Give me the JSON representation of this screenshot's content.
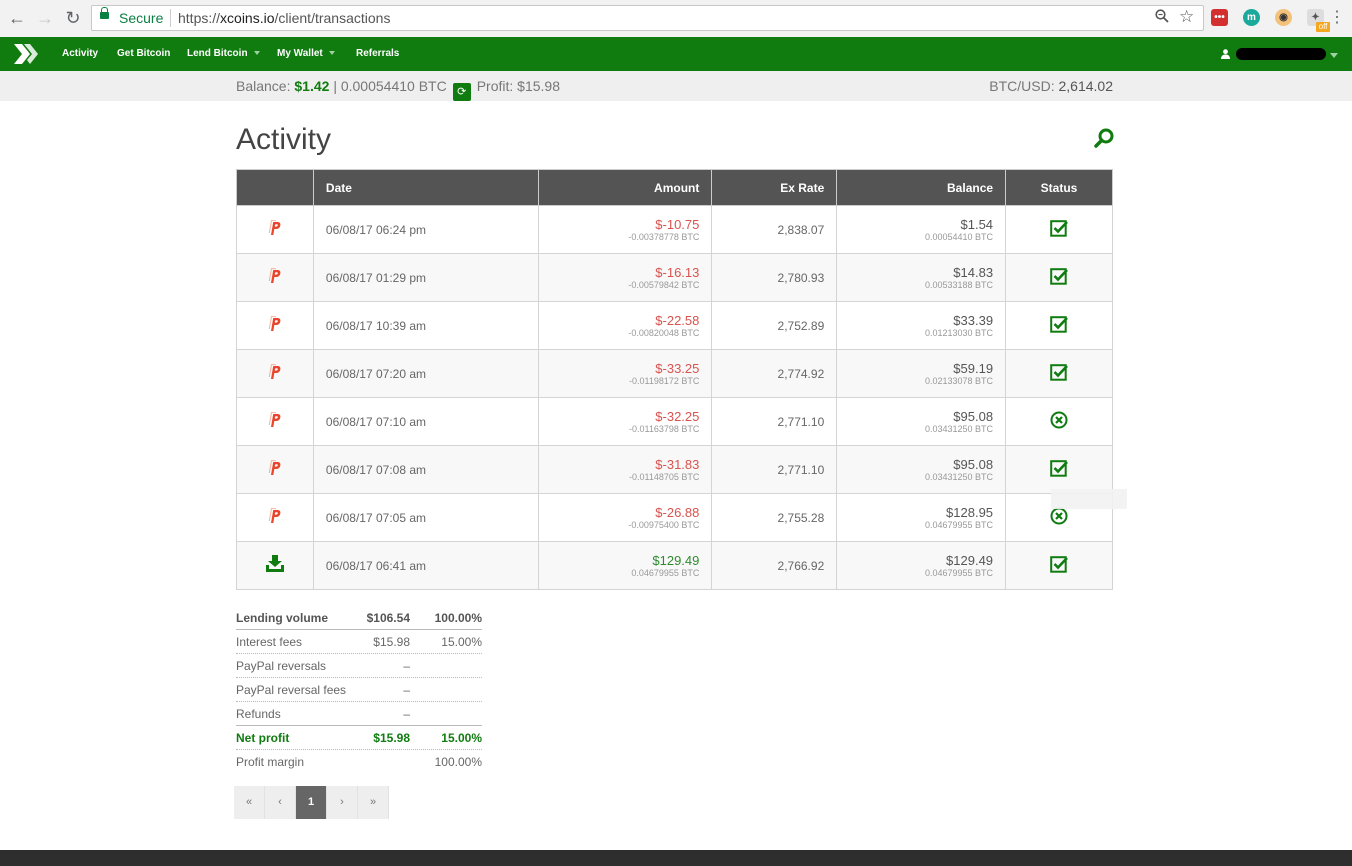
{
  "browser": {
    "secure_label": "Secure",
    "url_scheme": "https://",
    "url_host": "xcoins.io",
    "url_path": "/client/transactions",
    "extension_off_label": "off"
  },
  "nav": {
    "items": [
      {
        "label": "Activity",
        "dropdown": false
      },
      {
        "label": "Get Bitcoin",
        "dropdown": false
      },
      {
        "label": "Lend Bitcoin",
        "dropdown": true
      },
      {
        "label": "My Wallet",
        "dropdown": true
      },
      {
        "label": "Referrals",
        "dropdown": false
      }
    ]
  },
  "balance_bar": {
    "balance_label": "Balance:",
    "balance_usd": "$1.42",
    "balance_btc": "| 0.00054410 BTC",
    "profit_label": "Profit:",
    "profit_value": "$15.98",
    "rate_label": "BTC/USD:",
    "rate_value": "2,614.02"
  },
  "page": {
    "title": "Activity"
  },
  "table": {
    "headers": {
      "date": "Date",
      "amount": "Amount",
      "ex_rate": "Ex Rate",
      "balance": "Balance",
      "status": "Status"
    },
    "rows": [
      {
        "type": "paypal",
        "date": "06/08/17 06:24 pm",
        "amount": "$-10.75",
        "amount_btc": "-0.00378778 BTC",
        "positive": false,
        "ex_rate": "2,838.07",
        "balance": "$1.54",
        "balance_btc": "0.00054410 BTC",
        "status": "complete"
      },
      {
        "type": "paypal",
        "date": "06/08/17 01:29 pm",
        "amount": "$-16.13",
        "amount_btc": "-0.00579842 BTC",
        "positive": false,
        "ex_rate": "2,780.93",
        "balance": "$14.83",
        "balance_btc": "0.00533188 BTC",
        "status": "complete"
      },
      {
        "type": "paypal",
        "date": "06/08/17 10:39 am",
        "amount": "$-22.58",
        "amount_btc": "-0.00820048 BTC",
        "positive": false,
        "ex_rate": "2,752.89",
        "balance": "$33.39",
        "balance_btc": "0.01213030 BTC",
        "status": "complete"
      },
      {
        "type": "paypal",
        "date": "06/08/17 07:20 am",
        "amount": "$-33.25",
        "amount_btc": "-0.01198172 BTC",
        "positive": false,
        "ex_rate": "2,774.92",
        "balance": "$59.19",
        "balance_btc": "0.02133078 BTC",
        "status": "complete"
      },
      {
        "type": "paypal",
        "date": "06/08/17 07:10 am",
        "amount": "$-32.25",
        "amount_btc": "-0.01163798 BTC",
        "positive": false,
        "ex_rate": "2,771.10",
        "balance": "$95.08",
        "balance_btc": "0.03431250 BTC",
        "status": "cancelled"
      },
      {
        "type": "paypal",
        "date": "06/08/17 07:08 am",
        "amount": "$-31.83",
        "amount_btc": "-0.01148705 BTC",
        "positive": false,
        "ex_rate": "2,771.10",
        "balance": "$95.08",
        "balance_btc": "0.03431250 BTC",
        "status": "complete"
      },
      {
        "type": "paypal",
        "date": "06/08/17 07:05 am",
        "amount": "$-26.88",
        "amount_btc": "-0.00975400 BTC",
        "positive": false,
        "ex_rate": "2,755.28",
        "balance": "$128.95",
        "balance_btc": "0.04679955 BTC",
        "status": "cancelled"
      },
      {
        "type": "deposit",
        "date": "06/08/17 06:41 am",
        "amount": "$129.49",
        "amount_btc": "0.04679955 BTC",
        "positive": true,
        "ex_rate": "2,766.92",
        "balance": "$129.49",
        "balance_btc": "0.04679955 BTC",
        "status": "complete"
      }
    ]
  },
  "summary": [
    {
      "label": "Lending volume",
      "value": "$106.54",
      "pct": "100.00%",
      "style": "bold solid"
    },
    {
      "label": "Interest fees",
      "value": "$15.98",
      "pct": "15.00%",
      "style": ""
    },
    {
      "label": "PayPal reversals",
      "value": "–",
      "pct": "",
      "style": ""
    },
    {
      "label": "PayPal reversal fees",
      "value": "–",
      "pct": "",
      "style": ""
    },
    {
      "label": "Refunds",
      "value": "–",
      "pct": "",
      "style": "solid"
    },
    {
      "label": "Net profit",
      "value": "$15.98",
      "pct": "15.00%",
      "style": "green"
    },
    {
      "label": "Profit margin",
      "value": "",
      "pct": "100.00%",
      "style": ""
    }
  ],
  "pagination": {
    "first": "«",
    "prev": "‹",
    "current": "1",
    "next": "›",
    "last": "»"
  },
  "colors": {
    "brand_green": "#107c10",
    "negative_red": "#d9534f",
    "paypal_red": "#e8452c"
  }
}
